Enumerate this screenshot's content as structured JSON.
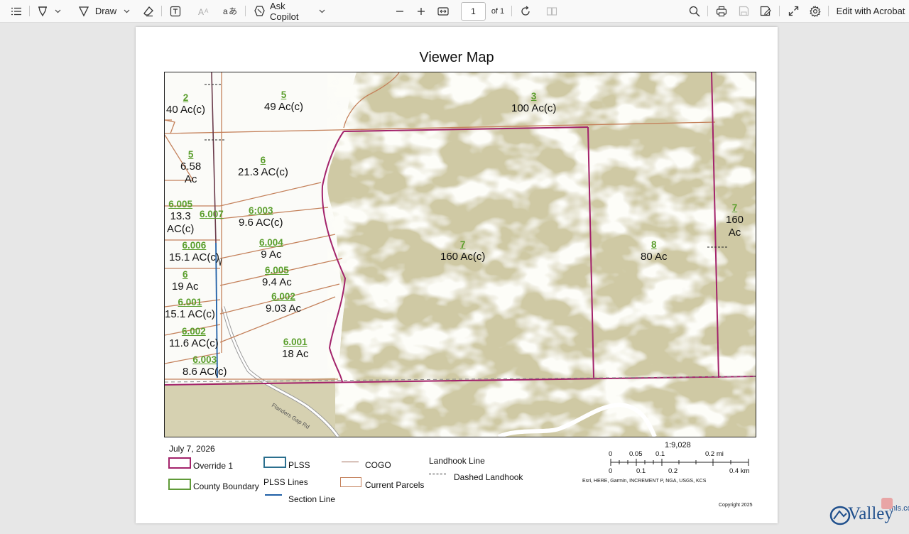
{
  "toolbar": {
    "draw_label": "Draw",
    "copilot_label": "Ask Copilot",
    "page_number": "1",
    "page_total": "of 1",
    "edit_label": "Edit with Acrobat"
  },
  "map": {
    "title": "Viewer Map",
    "parcels": [
      {
        "num": "2",
        "area": "40 Ac(c)"
      },
      {
        "num": "5",
        "area": "49 Ac(c)"
      },
      {
        "num": "3",
        "area": "100 Ac(c)"
      },
      {
        "num": "5",
        "area_line1": "6.58",
        "area_line2": "Ac"
      },
      {
        "num": "6",
        "area": "21.3 AC(c)"
      },
      {
        "num": "6.005",
        "area_line1": "13.3",
        "area_line2": "AC(c)"
      },
      {
        "num": "6.007"
      },
      {
        "num": "6:003",
        "area": "9.6 AC(c)"
      },
      {
        "num": "6.006",
        "area": "15.1 AC(c)"
      },
      {
        "num": "6.004",
        "area": "9 Ac"
      },
      {
        "num": "6",
        "area": "19 Ac"
      },
      {
        "num": "6.005",
        "area": "9.4 Ac"
      },
      {
        "num": "6.002",
        "area": "9.03 Ac"
      },
      {
        "num": "6.001",
        "area": "15.1 AC(c)"
      },
      {
        "num": "6.002",
        "area": "11.6 AC(c)"
      },
      {
        "num": "6.001",
        "area": "18 Ac"
      },
      {
        "num": "6.003",
        "area": "8.6 AC(c)"
      },
      {
        "num": "7",
        "area": "160 Ac(c)"
      },
      {
        "num": "8",
        "area": "80 Ac"
      },
      {
        "num": "7",
        "area_line1": "160",
        "area_line2": "Ac"
      }
    ],
    "road_label": "Flanders Gap Rd"
  },
  "legend": {
    "date": "July 7, 2026",
    "override": "Override 1",
    "plss": "PLSS",
    "cogo": "COGO",
    "landhook": "Landhook Line",
    "dashed_landhook": "Dashed Landhook",
    "county_boundary": "County Boundary",
    "plss_lines": "PLSS Lines",
    "current_parcels": "Current Parcels",
    "section_line": "Section Line",
    "colors": {
      "override": "#a3236b",
      "plss": "#2b6f8e",
      "county": "#5f9a38",
      "parcels": "#c4815b",
      "section": "#1f5fa6"
    }
  },
  "scale": {
    "ratio": "1:9,028",
    "mi_ticks": [
      "0",
      "0.05",
      "0.1",
      "0.2 mi"
    ],
    "km_ticks": [
      "0",
      "0.1",
      "0.2",
      "0.4 km"
    ],
    "attribution": "Esri, HERE, Garmin, INCREMENT P, NGA, USGS, KCS",
    "copyright": "Copyright 2025"
  },
  "watermark": {
    "brand": "Valley",
    "domain": "mls.com"
  }
}
